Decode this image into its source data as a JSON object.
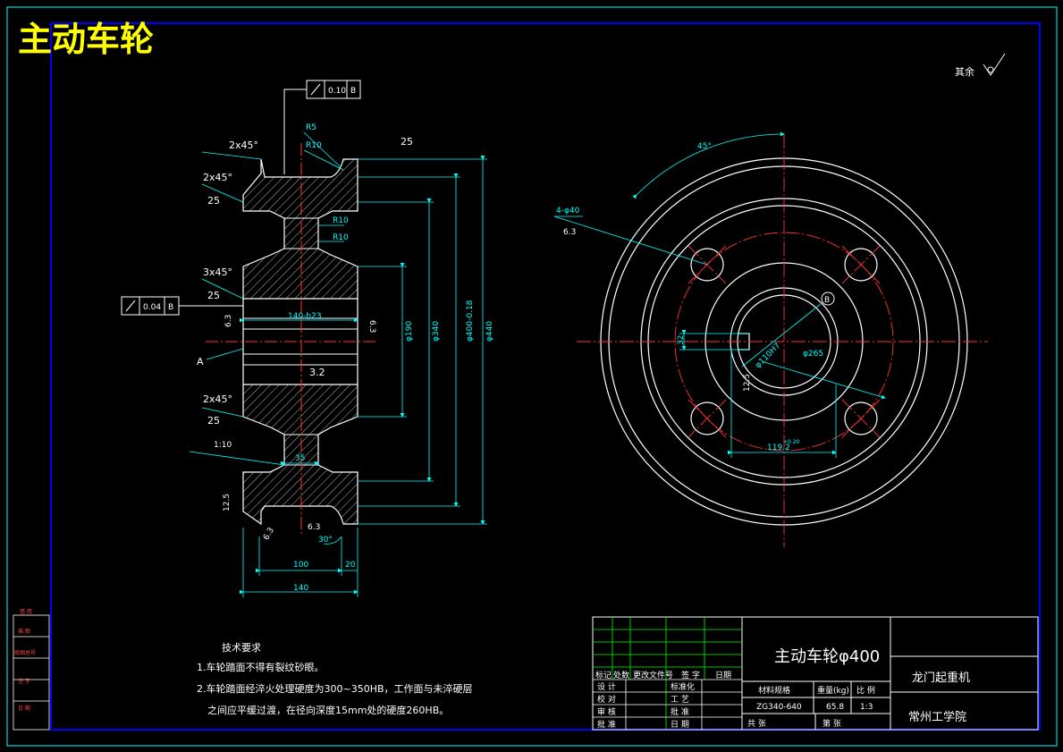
{
  "title": "主动车轮",
  "roughness_note": "其余",
  "drawing": {
    "tolerance_top": {
      "value": "0.10",
      "datum": "B"
    },
    "tolerance_left": {
      "value": "0.04",
      "datum": "B"
    },
    "labels": {
      "chamfer_top": "2x45°",
      "chamfer_2": "2x45°",
      "chamfer_3": "3x45°",
      "chamfer_4": "2x45°",
      "rough_25": "25",
      "rough_25b": "25",
      "rough_25c": "25",
      "rough_25d": "25",
      "r5": "R5",
      "r10_top": "R10",
      "r10_a": "R10",
      "r10_b": "R10",
      "bore_dim": "140-b23",
      "rough_63_l": "6.3",
      "rough_63_r": "6.3",
      "rough_32": "3.2",
      "rough_63_b": "6.3",
      "rough_63_c": "6.3",
      "rough_125": "12.5",
      "datum_a": "A",
      "taper": "1:10",
      "dim_35": "35",
      "dim_100": "100",
      "dim_20": "20",
      "dim_140": "140",
      "angle_30": "30°",
      "dia_190": "φ190",
      "dia_340": "φ340",
      "dia_400": "φ400-0.18",
      "dia_440": "φ440",
      "hole_note": "4-φ40",
      "hole_rough": "6.3",
      "angle_45": "45°",
      "datum_b": "B",
      "dia_265": "φ265",
      "keyway_w": "32",
      "keyway_dim": "119.2",
      "keyway_tol": "+0.20",
      "rough_125_r": "12.5",
      "bore_r": "φ110H7"
    }
  },
  "notes": {
    "heading": "技术要求",
    "line1": "1.车轮踏面不得有裂纹砂眼。",
    "line2": "2.车轮踏面经淬火处理硬度为300~350HB，工作面与未淬硬层",
    "line3": "之间应平缓过渡，在径向深度15mm处的硬度260HB。"
  },
  "title_block": {
    "part_name": "主动车轮φ400",
    "machine": "龙门起重机",
    "school": "常州工学院",
    "material_hdr": "材料规格",
    "weight_hdr": "重量(kg)",
    "scale_hdr": "比 例",
    "material": "ZG340-640",
    "weight": "65.8",
    "scale": "1:3",
    "sheets_total": "共 张",
    "sheet_no": "第 张",
    "col_mark": "标记",
    "col_count": "处数",
    "col_file": "更改文件号",
    "col_sign": "签 字",
    "col_date": "日期",
    "row_design": "设 计",
    "row_check": "校 对",
    "row_review": "审 核",
    "row_approve": "批 准",
    "c_std": "标准化",
    "c_process": "工 艺",
    "c_approve": "批 准",
    "c_date": "日 期"
  },
  "side_labels": [
    "借 用",
    "描 图",
    "底图总号",
    "签 字",
    "日 期"
  ]
}
